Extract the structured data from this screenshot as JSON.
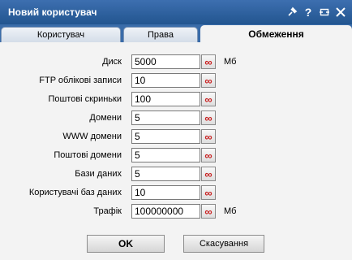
{
  "window": {
    "title": "Новий користувач",
    "icons": [
      "pin-icon",
      "help-icon",
      "maximize-icon",
      "close-icon"
    ],
    "help_glyph": "?"
  },
  "tabs": [
    {
      "label": "Користувач",
      "active": false
    },
    {
      "label": "Права",
      "active": false
    },
    {
      "label": "Обмеження",
      "active": true
    }
  ],
  "limits": [
    {
      "label": "Диск",
      "value": "5000",
      "unit": "Мб"
    },
    {
      "label": "FTP облікові записи",
      "value": "10",
      "unit": ""
    },
    {
      "label": "Поштові скриньки",
      "value": "100",
      "unit": ""
    },
    {
      "label": "Домени",
      "value": "5",
      "unit": ""
    },
    {
      "label": "WWW домени",
      "value": "5",
      "unit": ""
    },
    {
      "label": "Поштові домени",
      "value": "5",
      "unit": ""
    },
    {
      "label": "Бази даних",
      "value": "5",
      "unit": ""
    },
    {
      "label": "Користувачі баз даних",
      "value": "10",
      "unit": ""
    },
    {
      "label": "Трафік",
      "value": "100000000",
      "unit": "Мб"
    }
  ],
  "infinity_glyph": "∞",
  "buttons": {
    "ok": "OK",
    "cancel": "Скасування"
  },
  "colors": {
    "titlebar": "#2a5b98",
    "infinity": "#c82020",
    "panel": "#f3f3f3"
  }
}
